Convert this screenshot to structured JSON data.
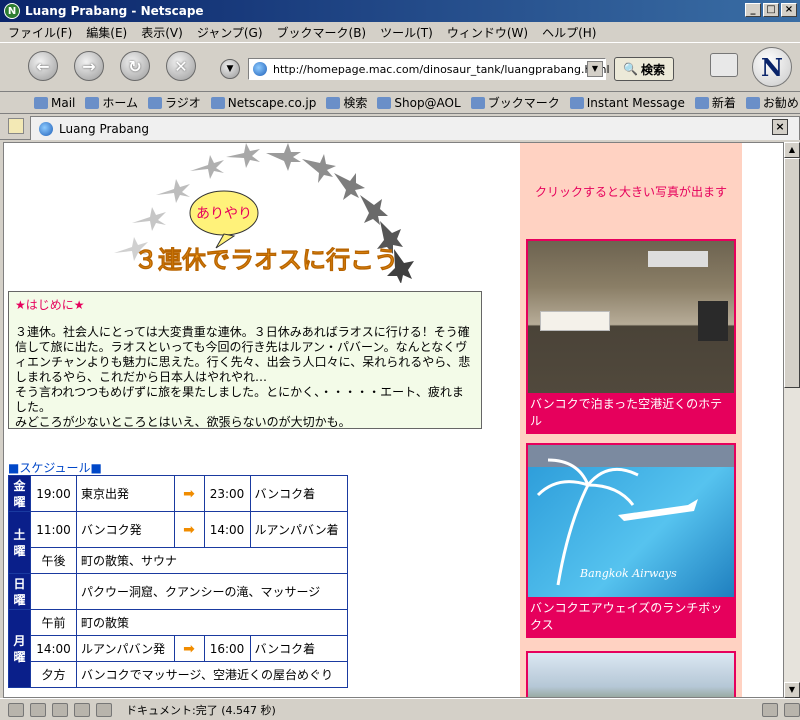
{
  "window": {
    "title": "Luang Prabang - Netscape"
  },
  "menu": [
    "ファイル(F)",
    "編集(E)",
    "表示(V)",
    "ジャンプ(G)",
    "ブックマーク(B)",
    "ツール(T)",
    "ウィンドウ(W)",
    "ヘルプ(H)"
  ],
  "nav": {
    "url": "http://homepage.mac.com/dinosaur_tank/luangprabang.html",
    "search_label": "検索"
  },
  "personal_toolbar": [
    "Mail",
    "ホーム",
    "ラジオ",
    "Netscape.co.jp",
    "検索",
    "Shop@AOL",
    "ブックマーク",
    "Instant Message",
    "新着",
    "お勧め"
  ],
  "tab": {
    "title": "Luang Prabang"
  },
  "page": {
    "banner": {
      "bubble": "ありやり",
      "headline": "３連休でラオスに行こう"
    },
    "intro": {
      "heading": "★はじめに★",
      "body": "３連休。社会人にとっては大変貴重な連休。３日休みあればラオスに行ける！そう確信して旅に出た。ラオスといっても今回の行き先はルアン・パバーン。なんとなくヴィエンチャンよりも魅力に思えた。行く先々、出会う人口々に、呆れられるやら、悲しまれるやら、これだから日本人はやれやれ…",
      "body2": "そう言われつつもめげずに旅を果たしました。とにかく、・・・・・エート、疲れました。",
      "body3": "みどころが少ないところとはいえ、欲張らないのが大切かも。"
    },
    "schedule": {
      "heading": "■スケジュール■",
      "rows": {
        "fri": {
          "day": "金曜",
          "t1": "19:00",
          "from": "東京出発",
          "arrow": "➡",
          "t2": "23:00",
          "to": "バンコク着"
        },
        "sat1": {
          "day": "土曜",
          "t1": "11:00",
          "from": "バンコク発",
          "arrow": "➡",
          "t2": "14:00",
          "to": "ルアンパバン着"
        },
        "sat2": {
          "t1": "午後",
          "text": "町の散策、サウナ"
        },
        "sun": {
          "day": "日曜",
          "text": "パクウー洞窟、クアンシーの滝、マッサージ"
        },
        "mon1": {
          "day": "月曜",
          "t1": "午前",
          "text": "町の散策"
        },
        "mon2": {
          "t1": "14:00",
          "from": "ルアンパバン発",
          "arrow": "➡",
          "t2": "16:00",
          "to": "バンコク着"
        },
        "mon3": {
          "t1": "夕方",
          "text": "バンコクでマッサージ、空港近くの屋台めぐり"
        }
      }
    },
    "sidebar": {
      "note": "クリックすると大きい写真が出ます",
      "photos": [
        "バンコクで泊まった空港近くのホテル",
        "バンコクエアウェイズのランチボックス"
      ],
      "box_text": "Bangkok Airways"
    }
  },
  "status": {
    "text": "ドキュメント:完了 (4.547 秒)"
  },
  "colors": {
    "accent": "#e6005c",
    "schedule_day_bg": "#0a1f8a",
    "sidebar_bg": "#ffd2c2",
    "intro_bg": "#f3fbe8"
  }
}
